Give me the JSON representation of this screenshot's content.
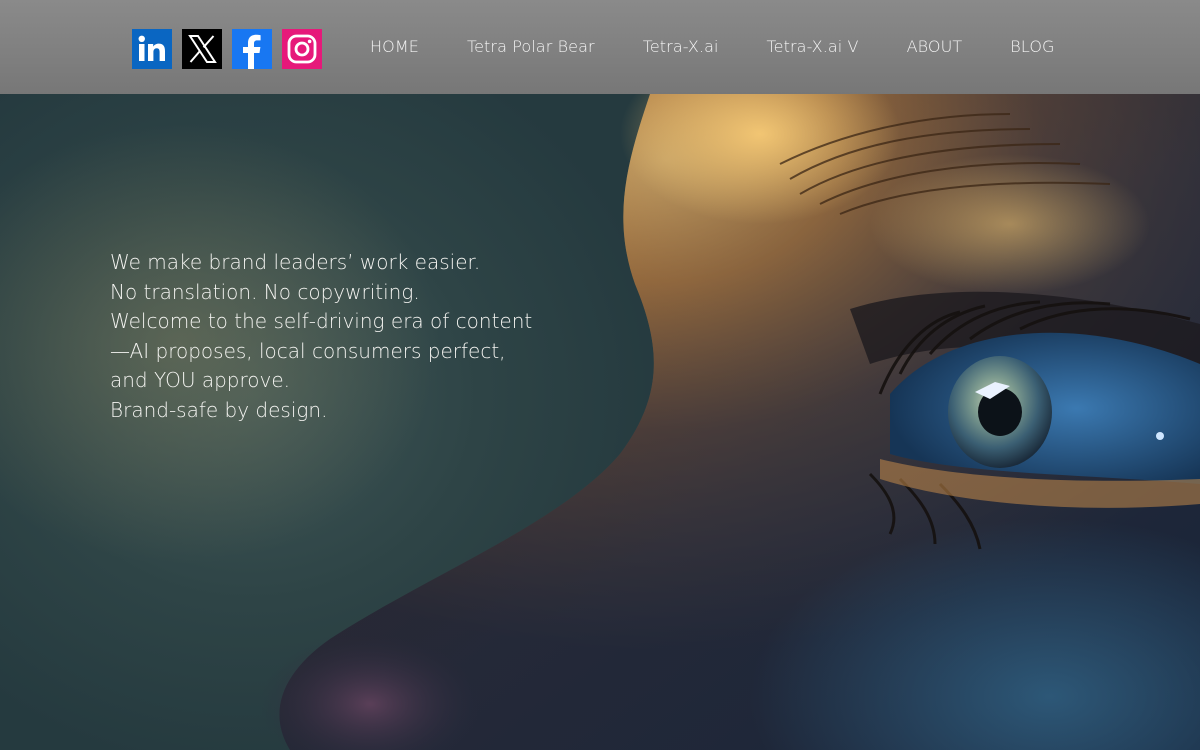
{
  "socials": [
    {
      "name": "LinkedIn",
      "icon": "linkedin-icon",
      "color": "#0a66c2"
    },
    {
      "name": "X",
      "icon": "x-icon",
      "color": "#000000"
    },
    {
      "name": "Facebook",
      "icon": "facebook-icon",
      "color": "#1877f2"
    },
    {
      "name": "Instagram",
      "icon": "instagram-icon",
      "color": "#e6197a"
    }
  ],
  "nav": {
    "items": [
      {
        "label": "HOME"
      },
      {
        "label": "Tetra Polar Bear"
      },
      {
        "label": "Tetra-X.ai"
      },
      {
        "label": "Tetra-X.ai V"
      },
      {
        "label": "ABOUT"
      },
      {
        "label": "BLOG"
      }
    ]
  },
  "hero": {
    "lines": [
      "We make brand leaders’ work easier.",
      "No translation. No copywriting.",
      "Welcome to the self-driving era of content",
      "—AI proposes, local consumers perfect,",
      "and YOU approve.",
      "Brand-safe by design."
    ]
  },
  "colors": {
    "header_bg": "#808080",
    "nav_text": "#f4f4f4",
    "hero_text": "#f3f3f0"
  }
}
